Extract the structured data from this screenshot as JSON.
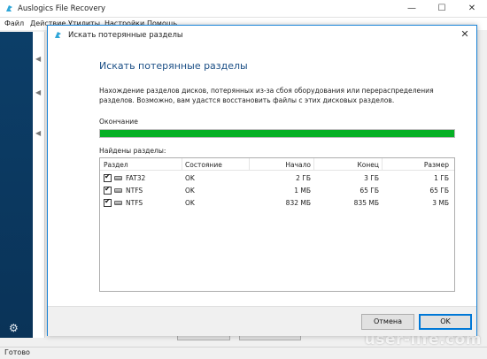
{
  "app": {
    "title": "Auslogics File Recovery",
    "window_controls": {
      "minimize": "—",
      "maximize": "☐",
      "close": "✕"
    },
    "menu": [
      "Файл",
      "Действие",
      "Утилиты",
      "Настройки",
      "Помощь"
    ],
    "status": "Готово",
    "sidebar_icon": "gear-icon",
    "watermark": "user-life.com"
  },
  "dialog": {
    "title": "Искать потерянные разделы",
    "close": "✕",
    "heading": "Искать потерянные разделы",
    "description": "Нахождение разделов дисков, потерянных из-за сбоя оборудования или перераспределения разделов. Возможно, вам удастся восстановить файлы с этих дисковых разделов.",
    "progress": {
      "label": "Окончание",
      "percent": 100,
      "color": "#06b025"
    },
    "found_label": "Найдены разделы:",
    "table": {
      "columns": [
        "Раздел",
        "Состояние",
        "Начало",
        "Конец",
        "Размер"
      ],
      "rows": [
        {
          "checked": true,
          "name": "FAT32",
          "state": "OK",
          "start": "2 ГБ",
          "end": "3 ГБ",
          "size": "1 ГБ"
        },
        {
          "checked": true,
          "name": "NTFS",
          "state": "OK",
          "start": "1 МБ",
          "end": "65 ГБ",
          "size": "65 ГБ"
        },
        {
          "checked": true,
          "name": "NTFS",
          "state": "OK",
          "start": "832 МБ",
          "end": "835 МБ",
          "size": "3 МБ"
        }
      ]
    },
    "buttons": {
      "cancel": "Отмена",
      "ok": "OK"
    }
  },
  "colors": {
    "accent": "#1883d7",
    "sidebar": "#0c3e68",
    "heading": "#1b4f86"
  }
}
